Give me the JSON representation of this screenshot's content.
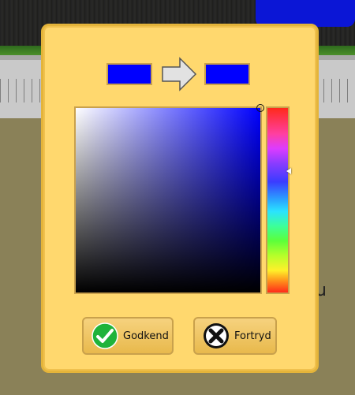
{
  "colors": {
    "selected": "#0000ff",
    "original": "#0000ff",
    "sv_hue_base": "#0000ff",
    "dialog_bg": "#ffd86e",
    "ok_icon": "#1fb33a",
    "cancel_icon": "#111111"
  },
  "picker": {
    "saturation": 1.0,
    "value": 1.0,
    "hue_position": 0.34
  },
  "buttons": {
    "ok_label": "Godkend",
    "cancel_label": "Fortryd"
  },
  "icons": {
    "arrow": "right-arrow-icon",
    "ok": "checkmark-icon",
    "cancel": "close-icon"
  },
  "background": {
    "partial_letter": "u"
  }
}
